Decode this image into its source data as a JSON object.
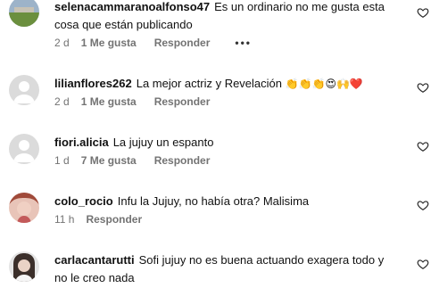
{
  "comments": [
    {
      "user": "selenacammaranoalfonso47",
      "text_line1": "Es un ordinario no me gusta esta",
      "text_line2": "cosa que están publicando",
      "time": "2 d",
      "likes": "1 Me gusta",
      "reply": "Responder",
      "more": "•••",
      "avatar": "field-photo"
    },
    {
      "user": "lilianflores262",
      "text_line1": "La mejor actriz y Revelación",
      "emojis": "👏👏👏😍🙌❤️",
      "time": "2 d",
      "likes": "1 Me gusta",
      "reply": "Responder",
      "avatar": "default-user"
    },
    {
      "user": "fiori.alicia",
      "text_line1": "La jujuy un espanto",
      "time": "1 d",
      "likes": "7 Me gusta",
      "reply": "Responder",
      "avatar": "default-user"
    },
    {
      "user": "colo_rocio",
      "text_line1": "Infu la Jujuy, no había otra? Malisima",
      "time": "11 h",
      "reply": "Responder",
      "avatar": "person-photo"
    },
    {
      "user": "carlacantarutti",
      "text_line1": "Sofi jujuy no es buena actuando exagera todo y",
      "text_line2": "no le creo nada",
      "avatar": "person-photo-2"
    }
  ]
}
